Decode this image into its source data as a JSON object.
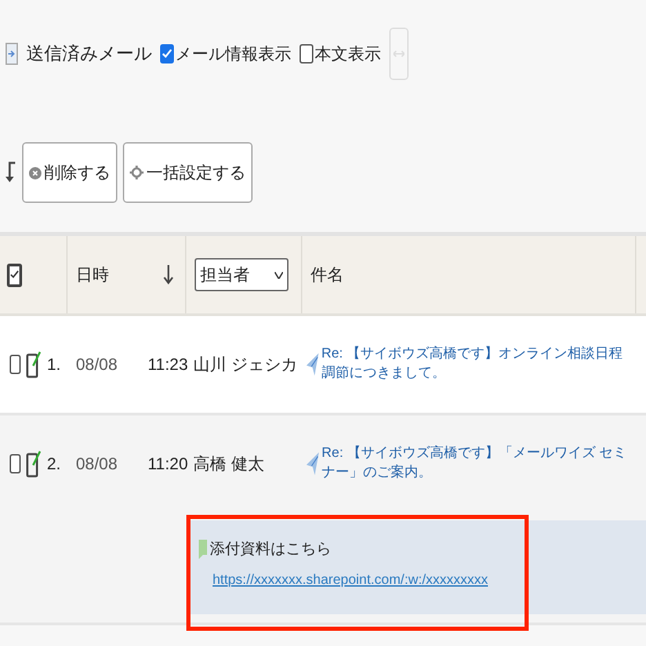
{
  "toolbar": {
    "folder": "送信済みメール",
    "options": [
      {
        "label": "メール情報表示",
        "checked": true
      },
      {
        "label": "本文表示",
        "checked": false
      }
    ]
  },
  "actions": [
    "削除する",
    "一括設定する"
  ],
  "table": {
    "columns": [
      {
        "label": "日時",
        "sort_descending": true
      },
      {
        "label": "担当者",
        "kind": "select"
      },
      {
        "label": "件名"
      }
    ],
    "select_all": {
      "checked": true
    },
    "rows": [
      {
        "checked": false,
        "number": "1.",
        "date": "08/08",
        "time": "11:23",
        "person": "山川 ジェシカ",
        "subject": "Re: 【サイボウズ高橋です】オンライン相談日程調節につきまして。"
      },
      {
        "checked": false,
        "number": "2.",
        "date": "08/08",
        "time": "11:20",
        "person": "高橋 健太",
        "subject": "Re: 【サイボウズ高橋です】「メールワイズ セミナー」のご案内。",
        "memo": {
          "title": "添付資料はこちら",
          "link": "https://xxxxxxx.sharepoint.com/:w:/xxxxxxxxx"
        }
      }
    ]
  }
}
